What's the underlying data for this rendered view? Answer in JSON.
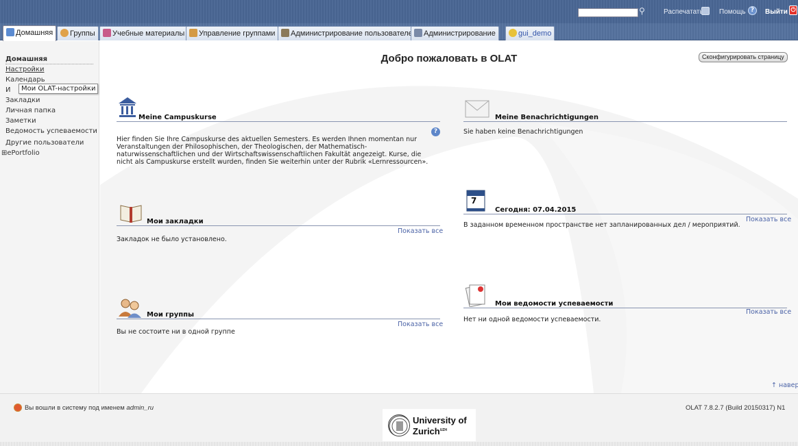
{
  "topbar": {
    "print": "Распечатать",
    "help": "Помощь",
    "logout": "Выйти",
    "help_icon_glyph": "?",
    "logout_icon_glyph": "⏻"
  },
  "tabs": [
    {
      "label": "Домашняя",
      "icon": "home-icon",
      "active": true
    },
    {
      "label": "Группы",
      "icon": "groups-icon"
    },
    {
      "label": "Учебные материалы",
      "icon": "learning-resources-icon"
    },
    {
      "label": "Управление группами",
      "icon": "group-management-icon"
    },
    {
      "label": "Администрирование пользователей",
      "icon": "user-admin-icon"
    },
    {
      "label": "Администрирование",
      "icon": "admin-icon"
    },
    {
      "label": "gui_demo",
      "icon": "gui-demo-icon"
    }
  ],
  "sidebar": {
    "items": [
      {
        "label": "Домашняя"
      },
      {
        "label": "Настройки"
      },
      {
        "label": "Календарь"
      },
      {
        "label": "И"
      },
      {
        "label": "Закладки"
      },
      {
        "label": "Личная папка"
      },
      {
        "label": "Заметки"
      },
      {
        "label": "Ведомость успеваемости"
      },
      {
        "label": "Другие пользователи"
      },
      {
        "label": "ePortfolio"
      }
    ],
    "tooltip": "Мои OLAT-настройки",
    "expand_glyph": "⊞"
  },
  "main": {
    "title": "Добро пожаловать в OLAT",
    "configure_button": "Сконфигурировать страницу",
    "top_link": "наверх",
    "top_link_glyph": "↑"
  },
  "portlets": {
    "campus": {
      "title": "Meine Campuskurse",
      "body": "Hier finden Sie Ihre Campuskurse des aktuellen Semesters. Es werden Ihnen momentan nur Veranstaltungen der Philosophischen, der Theologischen, der Mathematisch-naturwissenschaftlichen und der Wirtschaftswissenschaftlichen Fakultät angezeigt. Kurse, die nicht als Campuskurse erstellt wurden, finden Sie weiterhin unter der Rubrik «Lernressourcen».",
      "help_glyph": "?"
    },
    "notifications": {
      "title": "Meine Benachrichtigungen",
      "body": "Sie haben keine Benachrichtigungen"
    },
    "bookmarks": {
      "title": "Мои закладки",
      "body": "Закладок не было установлено.",
      "show_all": "Показать все"
    },
    "calendar": {
      "title": "Сегодня: 07.04.2015",
      "body": "В заданном временном пространстве нет запланированных дел / мероприятий.",
      "show_all": "Показать все",
      "day": "7"
    },
    "groups": {
      "title": "Мои группы",
      "body": "Вы не состоите ни в одной группе",
      "show_all": "Показать все"
    },
    "efficiency": {
      "title": "Мои ведомости успеваемости",
      "body": "Нет ни одной ведомости успеваемости.",
      "show_all": "Показать все"
    }
  },
  "footer": {
    "login_prefix": "Вы вошли в систему под именем",
    "login_user": "admin_ru",
    "version": "OLAT 7.8.2.7 (Build 20150317) N1",
    "uni_line1": "University of",
    "uni_line2": "Zurich",
    "uni_sup": "UZH"
  },
  "colors": {
    "topbar": "#4f6b97",
    "link": "#4a62a6",
    "logout_red": "#e4322b"
  }
}
